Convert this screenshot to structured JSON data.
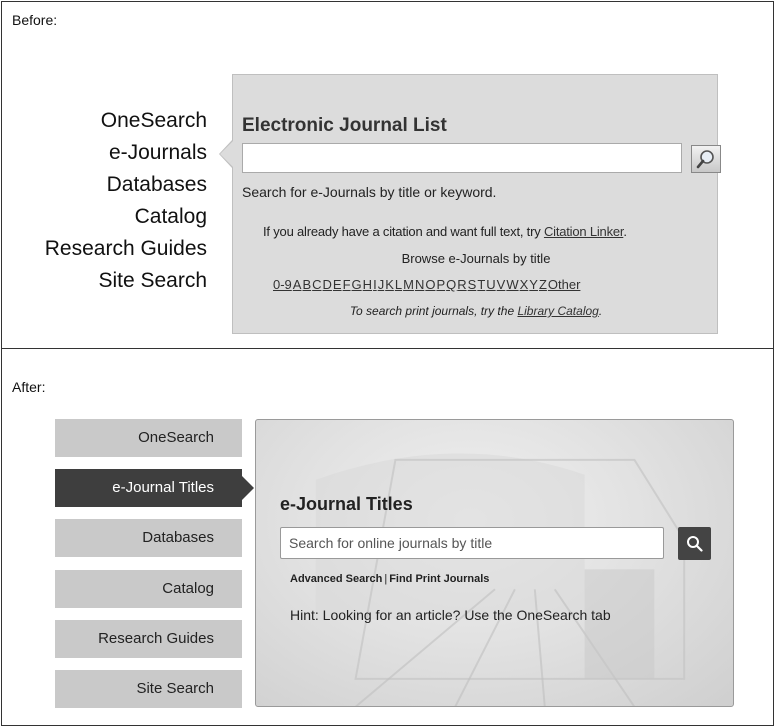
{
  "before": {
    "caption": "Before:",
    "tabs": [
      "OneSearch",
      "e-Journals",
      "Databases",
      "Catalog",
      "Research Guides",
      "Site Search"
    ],
    "title": "Electronic Journal List",
    "search_hint": "Search for e-Journals by title or keyword.",
    "citation_text": "If you already have a citation and want full text, try ",
    "citation_link": "Citation Linker",
    "citation_end": ".",
    "browse_label": "Browse e-Journals by title",
    "letters": [
      "0-9",
      "A",
      "B",
      "C",
      "D",
      "E",
      "F",
      "G",
      "H",
      "I",
      "J",
      "K",
      "L",
      "M",
      "N",
      "O",
      "P",
      "Q",
      "R",
      "S",
      "T",
      "U",
      "V",
      "W",
      "X",
      "Y",
      "Z",
      "Other"
    ],
    "print_text": "To search print journals, try the ",
    "print_link": "Library Catalog",
    "print_end": "."
  },
  "after": {
    "caption": "After:",
    "tabs": [
      "OneSearch",
      "e-Journal Titles",
      "Databases",
      "Catalog",
      "Research Guides",
      "Site Search"
    ],
    "active_tab": "e-Journal Titles",
    "title": "e-Journal Titles",
    "search_placeholder": "Search for online journals by title",
    "advanced_link": "Advanced Search",
    "separator": "|",
    "print_link": "Find Print Journals",
    "hint": "Hint: Looking for an article? Use the OneSearch tab"
  },
  "icons": {
    "old_search": "magnifier-icon",
    "new_search": "search-icon"
  },
  "colors": {
    "old_panel": "#dcdcdc",
    "tab_bg": "#c9c9c9",
    "tab_active": "#3e3e3e",
    "search_btn": "#444444"
  }
}
